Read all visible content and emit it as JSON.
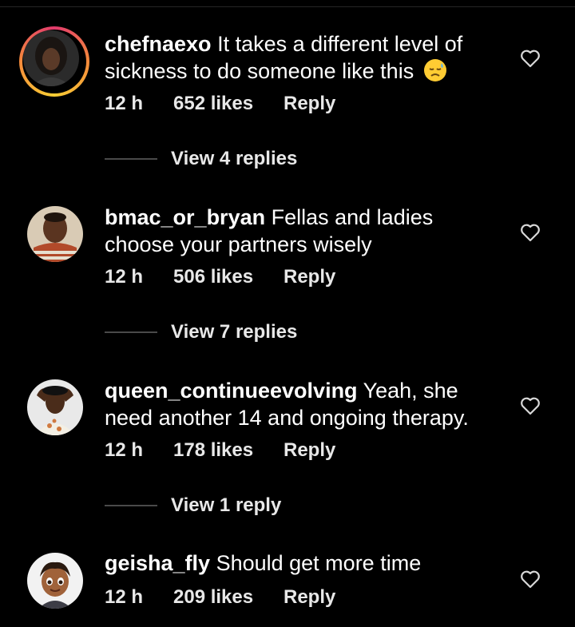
{
  "comments": [
    {
      "username": "chefnaexo",
      "text": "It takes a different level of sickness to do someone like this",
      "emoji": "frowning-sweat-face",
      "time": "12 h",
      "likes": "652 likes",
      "reply": "Reply",
      "view_replies": "View 4 replies",
      "has_story": true
    },
    {
      "username": "bmac_or_bryan",
      "text": "Fellas and ladies choose your partners wisely",
      "time": "12 h",
      "likes": "506 likes",
      "reply": "Reply",
      "view_replies": "View 7 replies",
      "has_story": false
    },
    {
      "username": "queen_continueevolving",
      "text": "Yeah, she need another 14 and ongoing therapy.",
      "time": "12 h",
      "likes": "178 likes",
      "reply": "Reply",
      "view_replies": "View 1 reply",
      "has_story": false
    },
    {
      "username": "geisha_fly",
      "text": "Should get more time",
      "time": "12 h",
      "likes": "209 likes",
      "reply": "Reply",
      "has_story": false
    }
  ],
  "colors": {
    "background": "#000000",
    "text": "#ffffff",
    "meta_text": "#e8e8e8",
    "divider": "#4a4a4a",
    "story_ring_start": "#e23a6d",
    "story_ring_end": "#f9ce34"
  },
  "icons": {
    "like": "heart-outline-icon"
  }
}
